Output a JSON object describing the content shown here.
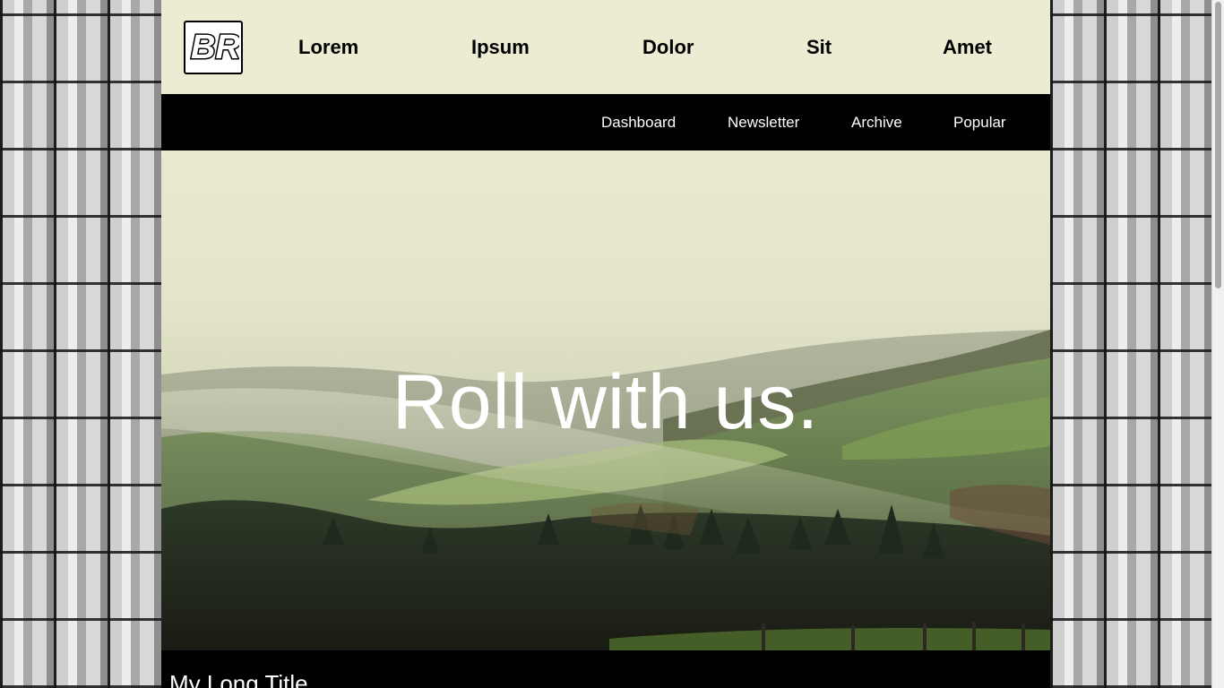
{
  "brand": {
    "logo_text": "BR"
  },
  "main_nav": {
    "items": [
      {
        "label": "Lorem"
      },
      {
        "label": "Ipsum"
      },
      {
        "label": "Dolor"
      },
      {
        "label": "Sit"
      },
      {
        "label": "Amet"
      }
    ]
  },
  "sub_nav": {
    "items": [
      {
        "label": "Dashboard"
      },
      {
        "label": "Newsletter"
      },
      {
        "label": "Archive"
      },
      {
        "label": "Popular"
      }
    ]
  },
  "hero": {
    "title": "Roll with us."
  },
  "post": {
    "title": "My Long Title"
  },
  "colors": {
    "header_bg": "#ececd2",
    "subnav_bg": "#000000",
    "text_dark": "#000000",
    "text_light": "#ffffff"
  }
}
